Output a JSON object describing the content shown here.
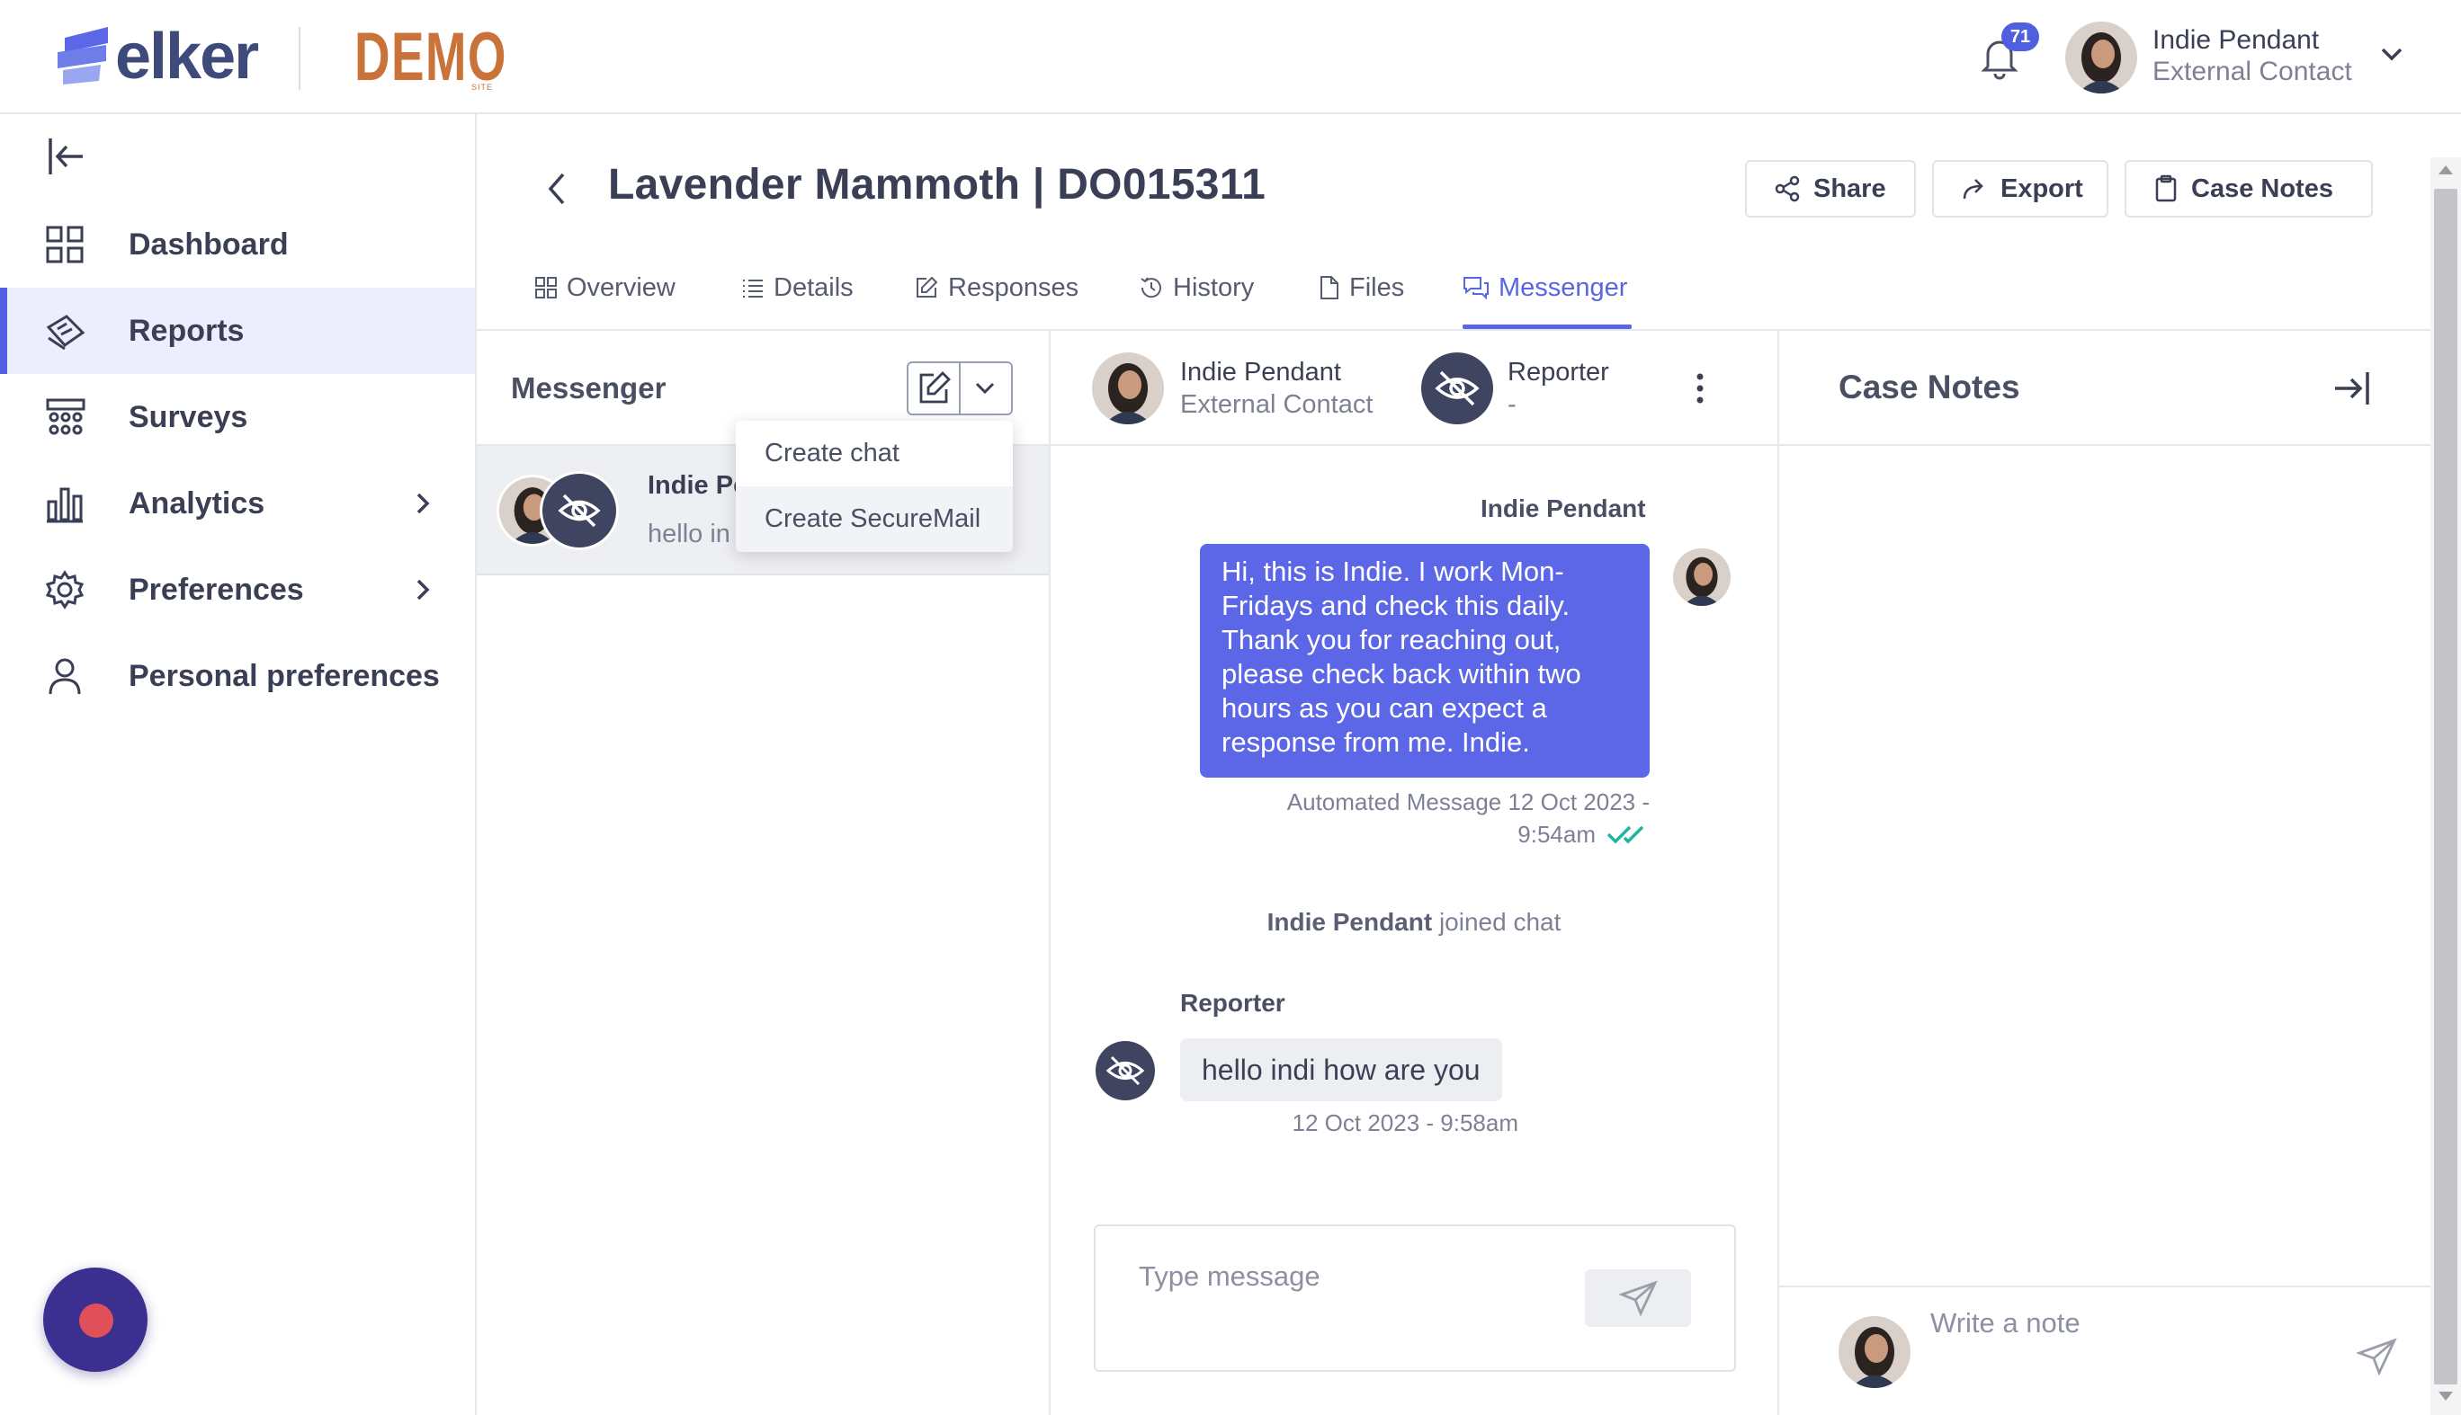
{
  "brand": {
    "name": "elker",
    "demo": "DEMO",
    "demo_sub": "SITE"
  },
  "header": {
    "notification_count": "71",
    "user_name": "Indie Pendant",
    "user_role": "External Contact"
  },
  "sidebar": {
    "items": [
      {
        "label": "Dashboard",
        "icon": "grid-icon",
        "active": false
      },
      {
        "label": "Reports",
        "icon": "reports-icon",
        "active": true
      },
      {
        "label": "Surveys",
        "icon": "surveys-icon",
        "active": false
      },
      {
        "label": "Analytics",
        "icon": "bar-chart-icon",
        "active": false,
        "has_submenu": true
      },
      {
        "label": "Preferences",
        "icon": "gear-icon",
        "active": false,
        "has_submenu": true
      },
      {
        "label": "Personal preferences",
        "icon": "person-icon",
        "active": false
      }
    ]
  },
  "page": {
    "title": "Lavender Mammoth | DO015311",
    "actions": {
      "share": "Share",
      "export": "Export",
      "case_notes": "Case Notes"
    },
    "tabs": [
      {
        "label": "Overview"
      },
      {
        "label": "Details"
      },
      {
        "label": "Responses"
      },
      {
        "label": "History"
      },
      {
        "label": "Files"
      },
      {
        "label": "Messenger",
        "active": true
      }
    ]
  },
  "messenger": {
    "title": "Messenger",
    "dropdown": [
      "Create chat",
      "Create SecureMail"
    ],
    "chat_list": [
      {
        "name": "Indie Pe",
        "preview": "hello in"
      }
    ]
  },
  "chat": {
    "participants": [
      {
        "name": "Indie Pendant",
        "role": "External Contact"
      },
      {
        "name": "Reporter",
        "role": "-"
      }
    ],
    "messages": [
      {
        "sender": "Indie Pendant",
        "text": "Hi, this is Indie. I work Mon-Fridays and check this daily. Thank you for reaching out, please check back within two hours as you can expect a response from me. Indie.",
        "meta_line1": "Automated Message 12 Oct 2023 -",
        "meta_line2": "9:54am"
      },
      {
        "sender": "Reporter",
        "text": "hello indi how are you",
        "meta": "12 Oct 2023 - 9:58am"
      }
    ],
    "joined": {
      "name": "Indie Pendant",
      "suffix": "joined chat"
    },
    "compose_placeholder": "Type message"
  },
  "case_notes": {
    "title": "Case Notes",
    "placeholder": "Write a note"
  },
  "colors": {
    "accent": "#5865e4",
    "brand": "#3d4a7a",
    "demo": "#c9733a",
    "fab": "#3b2f8f"
  }
}
